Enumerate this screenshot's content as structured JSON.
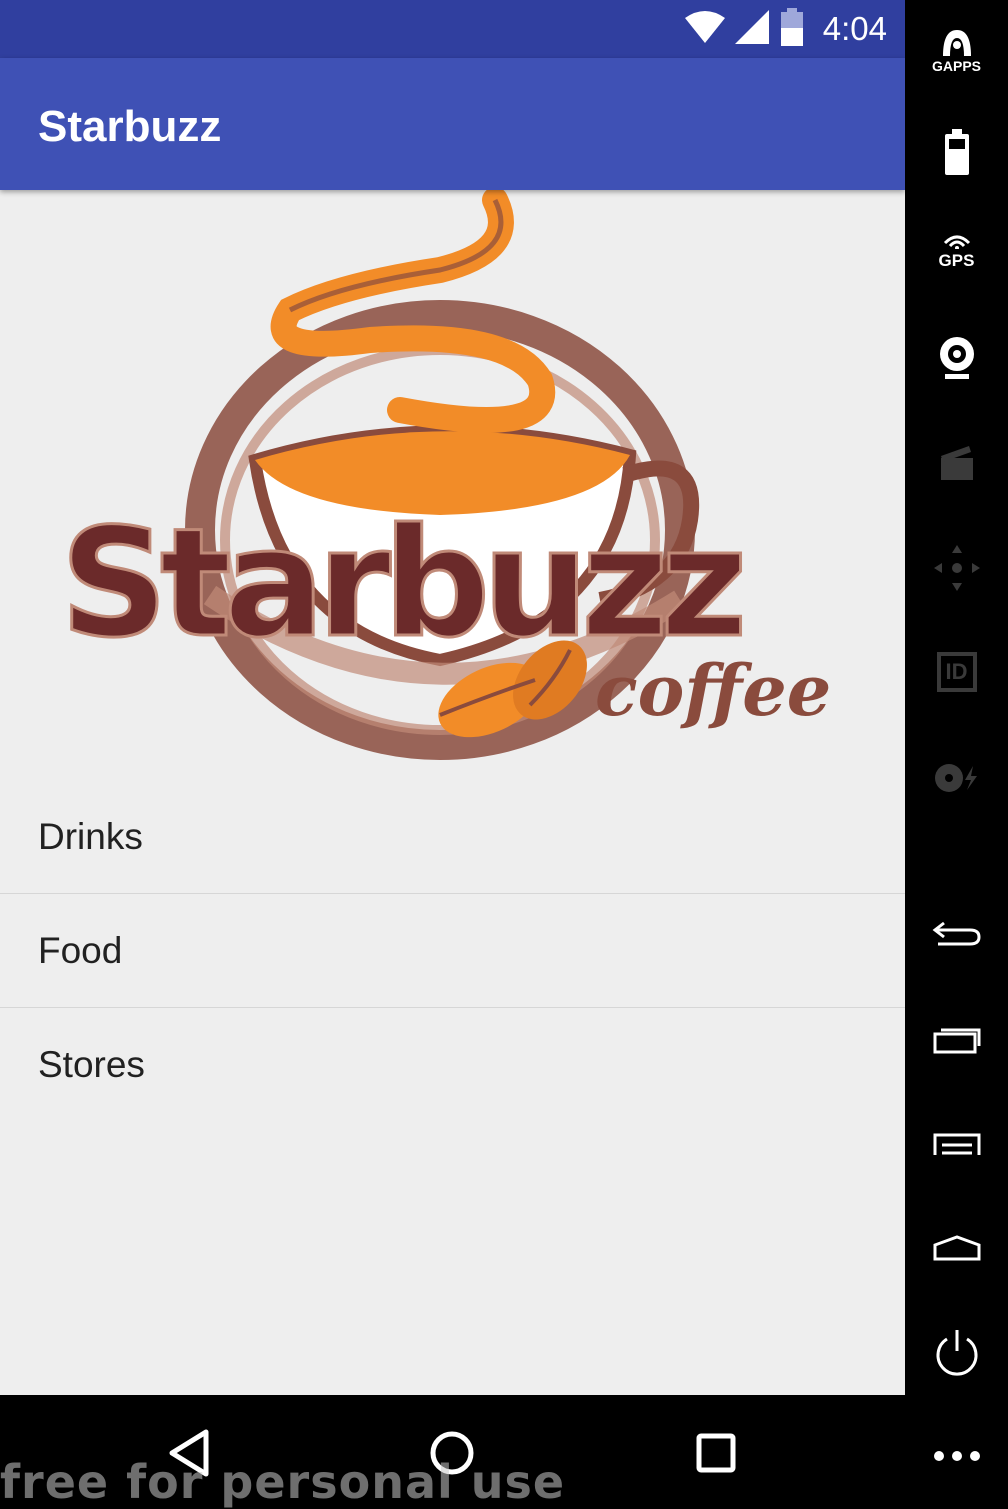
{
  "status_bar": {
    "time": "4:04"
  },
  "app_bar": {
    "title": "Starbuzz"
  },
  "logo": {
    "wordmark": "Starbuzz",
    "subtitle": "coffee",
    "brand_color": "#6b2a2a",
    "accent_color": "#f28c28"
  },
  "list": {
    "items": [
      {
        "label": "Drinks"
      },
      {
        "label": "Food"
      },
      {
        "label": "Stores"
      }
    ]
  },
  "nav": {
    "back": "back-icon",
    "home": "home-icon",
    "recents": "recents-icon"
  },
  "watermark": "free for personal use",
  "side_toolbar": {
    "gapps_label": "GAPPS",
    "gps_label": "GPS",
    "id_label": "ID"
  },
  "colors": {
    "status_bar": "#303f9f",
    "app_bar": "#3f51b5",
    "background": "#eeeeee"
  }
}
